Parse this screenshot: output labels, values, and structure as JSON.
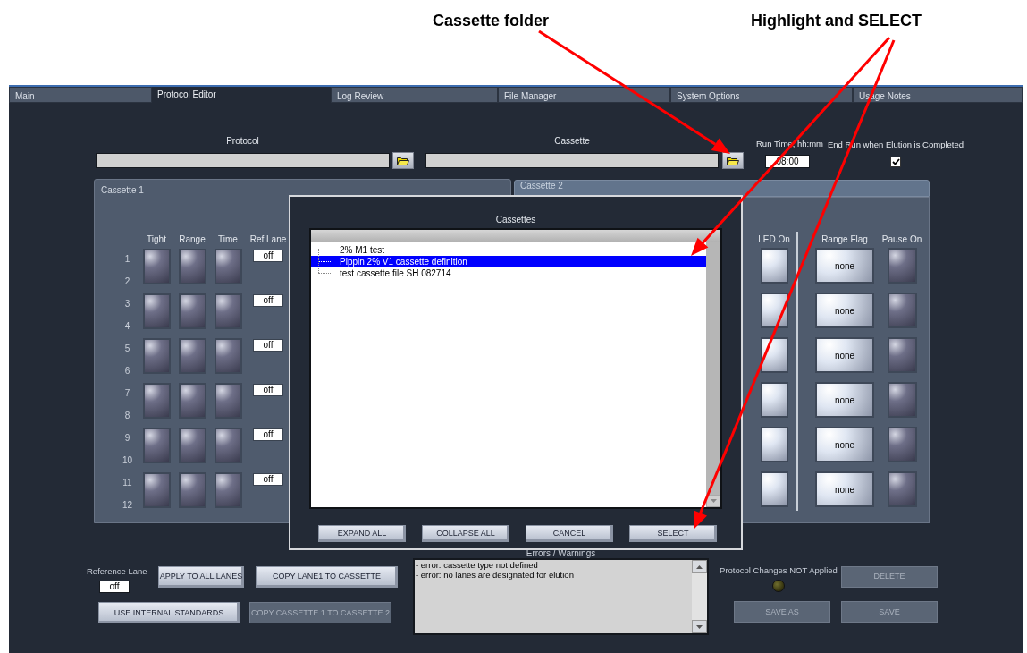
{
  "annotations": [
    {
      "text": "Cassette folder"
    },
    {
      "text": "Highlight and SELECT"
    }
  ],
  "tabs": [
    {
      "label": "Main",
      "selected": false
    },
    {
      "label": "Protocol Editor",
      "selected": true
    },
    {
      "label": "Log Review",
      "selected": false
    },
    {
      "label": "File Manager",
      "selected": false
    },
    {
      "label": "System Options",
      "selected": false
    },
    {
      "label": "Usage Notes",
      "selected": false
    }
  ],
  "protocol": {
    "label": "Protocol"
  },
  "cassette": {
    "label": "Cassette"
  },
  "run_time": {
    "label": "Run Time, hh:mm",
    "value": "08:00"
  },
  "end_run": {
    "label": "End Run when Elution is Completed",
    "checked": true
  },
  "cassette_1": {
    "title": "Cassette 1",
    "columns": [
      "Tight",
      "Range",
      "Time",
      "Ref Lane"
    ],
    "rows": [
      {
        "lanes": [
          "1",
          "2"
        ],
        "tight": false,
        "range": false,
        "time": false,
        "ref_lane": "off"
      },
      {
        "lanes": [
          "3",
          "4"
        ],
        "tight": false,
        "range": false,
        "time": false,
        "ref_lane": "off"
      },
      {
        "lanes": [
          "5",
          "6"
        ],
        "tight": false,
        "range": false,
        "time": false,
        "ref_lane": "off"
      },
      {
        "lanes": [
          "7",
          "8"
        ],
        "tight": false,
        "range": false,
        "time": false,
        "ref_lane": "off"
      },
      {
        "lanes": [
          "9",
          "10"
        ],
        "tight": false,
        "range": false,
        "time": false,
        "ref_lane": "off"
      },
      {
        "lanes": [
          "11",
          "12"
        ],
        "tight": false,
        "range": false,
        "time": false,
        "ref_lane": "off"
      }
    ]
  },
  "cassette_2": {
    "title": "Cassette 2",
    "columns": [
      "LED On",
      "Range Flag",
      "Pause On"
    ],
    "rows": [
      {
        "led_on": true,
        "range_flag": "none",
        "pause_on": false
      },
      {
        "led_on": true,
        "range_flag": "none",
        "pause_on": false
      },
      {
        "led_on": true,
        "range_flag": "none",
        "pause_on": false
      },
      {
        "led_on": true,
        "range_flag": "none",
        "pause_on": false
      },
      {
        "led_on": true,
        "range_flag": "none",
        "pause_on": false
      },
      {
        "led_on": true,
        "range_flag": "none",
        "pause_on": false
      }
    ]
  },
  "dialog": {
    "title": "Cassettes",
    "items": [
      {
        "label": "2% M1 test",
        "selected": false
      },
      {
        "label": "Pippin 2% V1 cassette definition",
        "selected": true
      },
      {
        "label": "test cassette file SH 082714",
        "selected": false
      }
    ],
    "buttons": [
      "EXPAND ALL",
      "COLLAPSE ALL",
      "CANCEL",
      "SELECT"
    ]
  },
  "errors": {
    "label": "Errors / Warnings",
    "lines": [
      "- error: cassette type not defined",
      "- error: no lanes are designated for elution"
    ]
  },
  "reference_lane": {
    "label": "Reference Lane",
    "value": "off"
  },
  "buttons": [
    {
      "label": "APPLY TO ALL LANES",
      "disabled": false
    },
    {
      "label": "COPY LANE1 TO CASSETTE",
      "disabled": false
    },
    {
      "label": "USE INTERNAL STANDARDS",
      "disabled": false
    },
    {
      "label": "COPY CASSETTE 1 TO CASSETTE 2",
      "disabled": true
    }
  ],
  "status": {
    "label": "Protocol Changes NOT Applied",
    "on": false
  },
  "file_buttons": [
    {
      "label": "DELETE",
      "disabled": true
    },
    {
      "label": "SAVE AS",
      "disabled": true
    },
    {
      "label": "SAVE",
      "disabled": true
    }
  ]
}
